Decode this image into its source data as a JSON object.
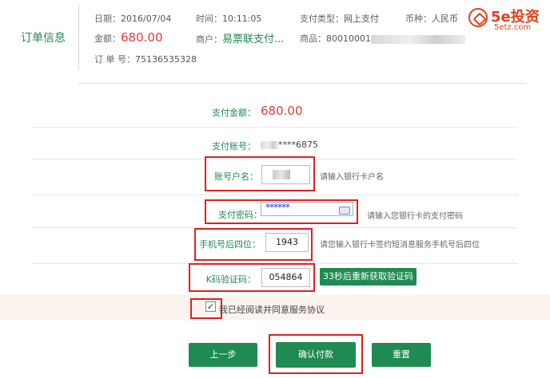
{
  "order": {
    "section_title": "订单信息",
    "date_label": "日期：",
    "date_value": "2016/07/04",
    "time_label": "时间：",
    "time_value": "10:11:05",
    "pay_type_label": "支付类型：",
    "pay_type_value": "网上支付",
    "currency_label": "币种：",
    "currency_value": "人民币",
    "amount_label": "金额：",
    "amount_value": "680.00",
    "merchant_label": "商户：",
    "merchant_value": "易票联支付...",
    "product_label": "商品：",
    "product_value": "80010001",
    "order_no_label": "订 单 号：",
    "order_no_value": "75136535328"
  },
  "logo": {
    "brand": "5e投资",
    "domain": "5etz.com"
  },
  "form": {
    "pay_amount_label": "支付金额：",
    "pay_amount_value": "680.00",
    "account_label": "支付账号：",
    "account_value": "****6875",
    "holder_label": "账号户名：",
    "holder_hint": "请输入银行卡户名",
    "password_label": "支付密码：",
    "password_value": "******",
    "password_hint": "请输入您银行卡的支付密码",
    "phone_label": "手机号后四位：",
    "phone_value": "1943",
    "phone_hint": "请您输入银行卡签约短消息服务手机号后四位",
    "code_label": "K码验证码：",
    "code_value": "054864",
    "resend_button": "33秒后重新获取验证码",
    "agree_checked": true,
    "agree_mark": "✓",
    "agree_text": "我已经阅读并同意服务协议"
  },
  "actions": {
    "back": "上一步",
    "confirm": "确认付款",
    "reset": "重置"
  },
  "colors": {
    "brand_green": "#1f8a52",
    "amount_red": "#e23b3b",
    "highlight_red": "#e02020",
    "logo_orange": "#e2401a"
  }
}
